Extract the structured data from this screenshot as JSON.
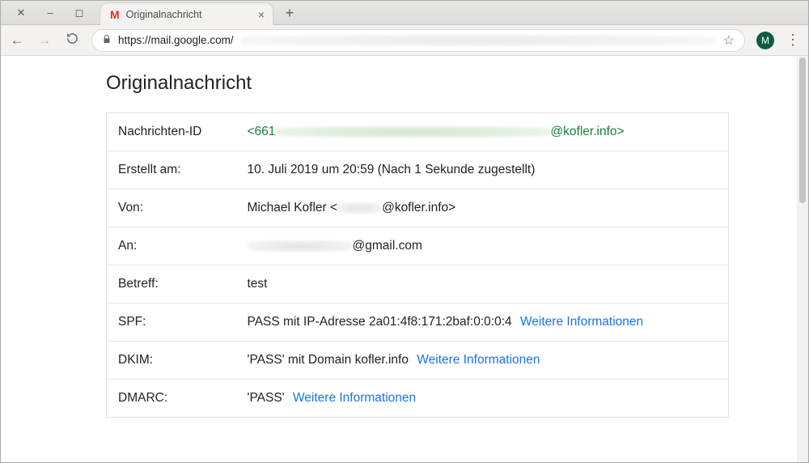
{
  "window": {
    "tab_title": "Originalnachricht"
  },
  "toolbar": {
    "url_host": "https://mail.google.com/",
    "avatar_initial": "M"
  },
  "page": {
    "title": "Originalnachricht",
    "more_info_label": "Weitere Informationen",
    "rows": {
      "message_id": {
        "label": "Nachrichten-ID",
        "value_prefix": "<661",
        "value_suffix": "@kofler.info>"
      },
      "created": {
        "label": "Erstellt am:",
        "value": "10. Juli 2019 um 20:59 (Nach 1 Sekunde zugestellt)"
      },
      "from": {
        "label": "Von:",
        "value_prefix": "Michael Kofler <",
        "value_suffix": "@kofler.info>"
      },
      "to": {
        "label": "An:",
        "value_suffix": "@gmail.com"
      },
      "subject": {
        "label": "Betreff:",
        "value": "test"
      },
      "spf": {
        "label": "SPF:",
        "value": "PASS mit IP-Adresse 2a01:4f8:171:2baf:0:0:0:4"
      },
      "dkim": {
        "label": "DKIM:",
        "value": "'PASS' mit Domain kofler.info"
      },
      "dmarc": {
        "label": "DMARC:",
        "value": "'PASS'"
      }
    }
  }
}
